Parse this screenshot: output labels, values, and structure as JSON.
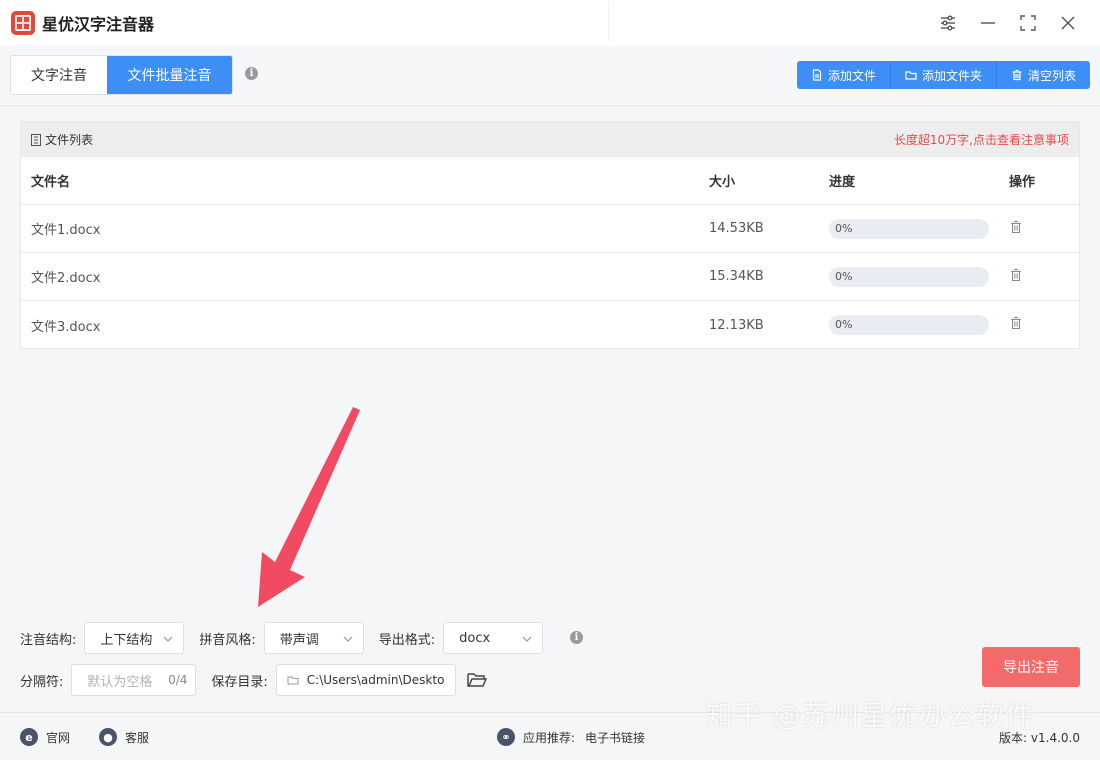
{
  "app": {
    "title": "星优汉字注音器"
  },
  "tabs": [
    {
      "label": "文字注音",
      "active": false
    },
    {
      "label": "文件批量注音",
      "active": true
    }
  ],
  "toolbar": {
    "add_file": "添加文件",
    "add_folder": "添加文件夹",
    "clear_list": "清空列表"
  },
  "file_list": {
    "title": "文件列表",
    "notice": "长度超10万字,点击查看注意事项",
    "columns": {
      "name": "文件名",
      "size": "大小",
      "progress": "进度",
      "action": "操作"
    },
    "rows": [
      {
        "name": "文件1.docx",
        "size": "14.53KB",
        "progress_text": "0%",
        "progress": 0
      },
      {
        "name": "文件2.docx",
        "size": "15.34KB",
        "progress_text": "0%",
        "progress": 0
      },
      {
        "name": "文件3.docx",
        "size": "12.13KB",
        "progress_text": "0%",
        "progress": 0
      }
    ]
  },
  "settings": {
    "structure_label": "注音结构:",
    "structure_value": "上下结构",
    "style_label": "拼音风格:",
    "style_value": "带声调",
    "format_label": "导出格式:",
    "format_value": "docx",
    "separator_label": "分隔符:",
    "separator_placeholder": "默认为空格",
    "separator_count": "0/4",
    "save_dir_label": "保存目录:",
    "save_dir_value": "C:\\Users\\admin\\Deskto"
  },
  "export_label": "导出注音",
  "footer": {
    "website": "官网",
    "service": "客服",
    "recommend_label": "应用推荐:",
    "recommend_link": "电子书链接",
    "version": "版本: v1.4.0.0"
  },
  "watermark": "知乎 @苏州星优办公软件",
  "colors": {
    "accent": "#3d8ef5",
    "export": "#f26a6a",
    "notice": "#e84a4a",
    "arrow": "#f04b62"
  },
  "icons": {
    "settings": "sliders-icon",
    "minimize": "minimize-icon",
    "maximize": "maximize-icon",
    "close": "close-icon"
  }
}
